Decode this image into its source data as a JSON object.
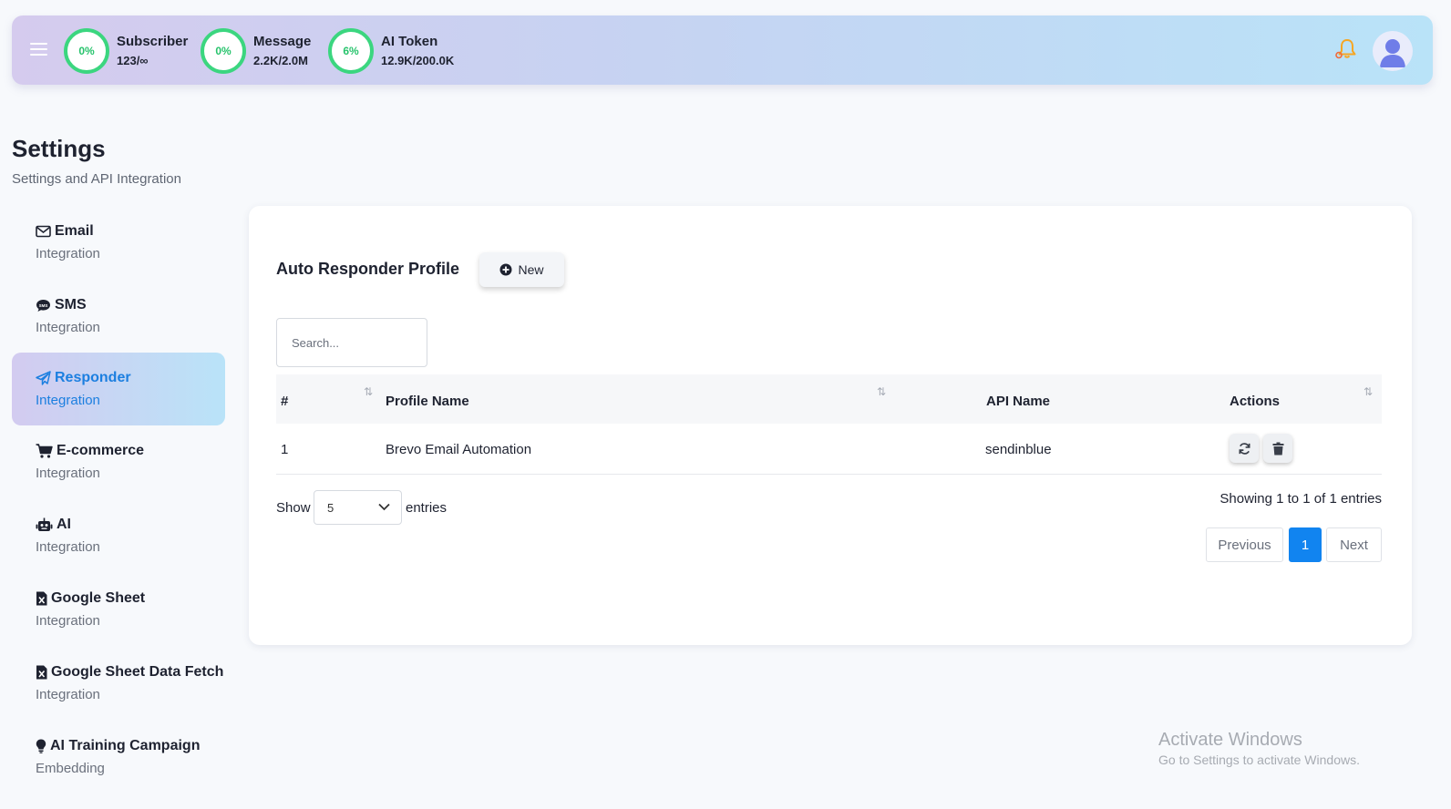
{
  "topbar": {
    "stats": [
      {
        "title": "Subscriber",
        "value": "123/∞",
        "percent": "0%"
      },
      {
        "title": "Message",
        "value": "2.2K/2.0M",
        "percent": "0%"
      },
      {
        "title": "AI Token",
        "value": "12.9K/200.0K",
        "percent": "6%"
      }
    ],
    "icons": {
      "menu": "hamburger-icon",
      "notifications": "bell-icon",
      "profile": "user-avatar"
    }
  },
  "header": {
    "title": "Settings",
    "subtitle": "Settings and API Integration"
  },
  "sidebar": {
    "items": [
      {
        "title": "Email",
        "sub": "Integration",
        "icon": "envelope-icon"
      },
      {
        "title": "SMS",
        "sub": "Integration",
        "icon": "sms-bubble-icon"
      },
      {
        "title": "Responder",
        "sub": "Integration",
        "icon": "paper-plane-icon",
        "active": true
      },
      {
        "title": "E-commerce",
        "sub": "Integration",
        "icon": "cart-icon"
      },
      {
        "title": "AI",
        "sub": "Integration",
        "icon": "robot-icon"
      },
      {
        "title": "Google Sheet",
        "sub": "Integration",
        "icon": "excel-file-icon"
      },
      {
        "title": "Google Sheet Data Fetch",
        "sub": "Integration",
        "icon": "excel-file-icon"
      },
      {
        "title": "AI Training Campaign",
        "sub": "Embedding",
        "icon": "lightbulb-icon"
      }
    ]
  },
  "main": {
    "title": "Auto Responder Profile",
    "new_label": "New",
    "search": {
      "placeholder": "Search...",
      "value": ""
    },
    "columns": [
      "#",
      "Profile Name",
      "API Name",
      "Actions"
    ],
    "rows": [
      {
        "index": "1",
        "profile_name": "Brevo Email Automation",
        "api_name": "sendinblue"
      }
    ],
    "show_label": "Show",
    "entries_value": "5",
    "entries_label": "entries",
    "info": "Showing 1 to 1 of 1 entries",
    "pagination": {
      "previous": "Previous",
      "current": "1",
      "next": "Next"
    }
  },
  "watermark": {
    "title": "Activate Windows",
    "sub": "Go to Settings to activate Windows."
  },
  "colors": {
    "accent": "#1184f0",
    "ring": "#3bd67f",
    "bell": "#f6a623"
  }
}
